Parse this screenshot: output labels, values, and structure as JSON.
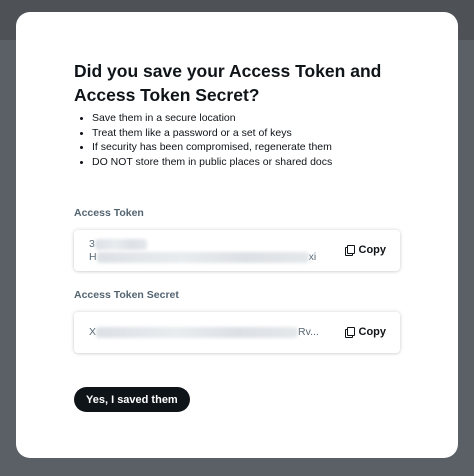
{
  "modal": {
    "title": "Did you save your Access Token and Access Token Secret?",
    "bullets": [
      "Save them in a secure location",
      "Treat them like a password or a set of keys",
      "If security has been compromised, regenerate them",
      "DO NOT store them in public places or shared docs"
    ],
    "access_token": {
      "label": "Access Token",
      "line1_visible": "3",
      "line2_start": "H",
      "line2_end": "xi",
      "copy_label": "Copy"
    },
    "access_token_secret": {
      "label": "Access Token Secret",
      "visible_start": "X",
      "visible_end": "Rv...",
      "copy_label": "Copy"
    },
    "confirm_button": "Yes, I saved them"
  },
  "colors": {
    "backdrop": "#5b6066",
    "modal_bg": "#ffffff",
    "text_primary": "#0f1419",
    "text_secondary": "#536471",
    "button_bg": "#0f1419"
  },
  "icons": {
    "copy": "copy-icon"
  }
}
